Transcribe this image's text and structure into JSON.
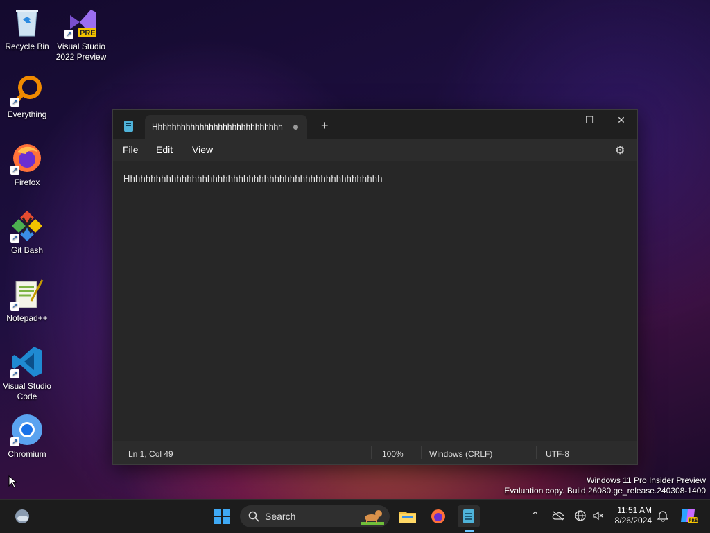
{
  "desktop": {
    "icons": [
      {
        "label": "Recycle Bin",
        "icon": "recycle-bin-icon"
      },
      {
        "label": "Visual Studio 2022 Preview",
        "icon": "visual-studio-preview-icon",
        "badge": "PRE"
      },
      {
        "label": "Everything",
        "icon": "everything-search-icon"
      },
      {
        "label": "Firefox",
        "icon": "firefox-icon"
      },
      {
        "label": "Git Bash",
        "icon": "git-bash-icon"
      },
      {
        "label": "Notepad++",
        "icon": "notepad-plus-plus-icon"
      },
      {
        "label": "Visual Studio Code",
        "icon": "vscode-icon"
      },
      {
        "label": "Chromium",
        "icon": "chromium-icon"
      }
    ],
    "watermark": {
      "line1": "Windows 11 Pro Insider Preview",
      "line2": "Evaluation copy. Build 26080.ge_release.240308-1400"
    }
  },
  "notepad": {
    "tab_title": "Hhhhhhhhhhhhhhhhhhhhhhhhhhhh",
    "menu": {
      "file": "File",
      "edit": "Edit",
      "view": "View"
    },
    "content": "Hhhhhhhhhhhhhhhhhhhhhhhhhhhhhhhhhhhhhhhhhhhhhhhhhh",
    "status": {
      "position": "Ln 1, Col 49",
      "zoom": "100%",
      "line_ending": "Windows (CRLF)",
      "encoding": "UTF-8"
    },
    "window_controls": {
      "minimize": "—",
      "maximize": "☐",
      "close": "✕"
    },
    "new_tab": "+"
  },
  "taskbar": {
    "search_label": "Search",
    "clock": {
      "time": "11:51 AM",
      "date": "8/26/2024"
    }
  }
}
